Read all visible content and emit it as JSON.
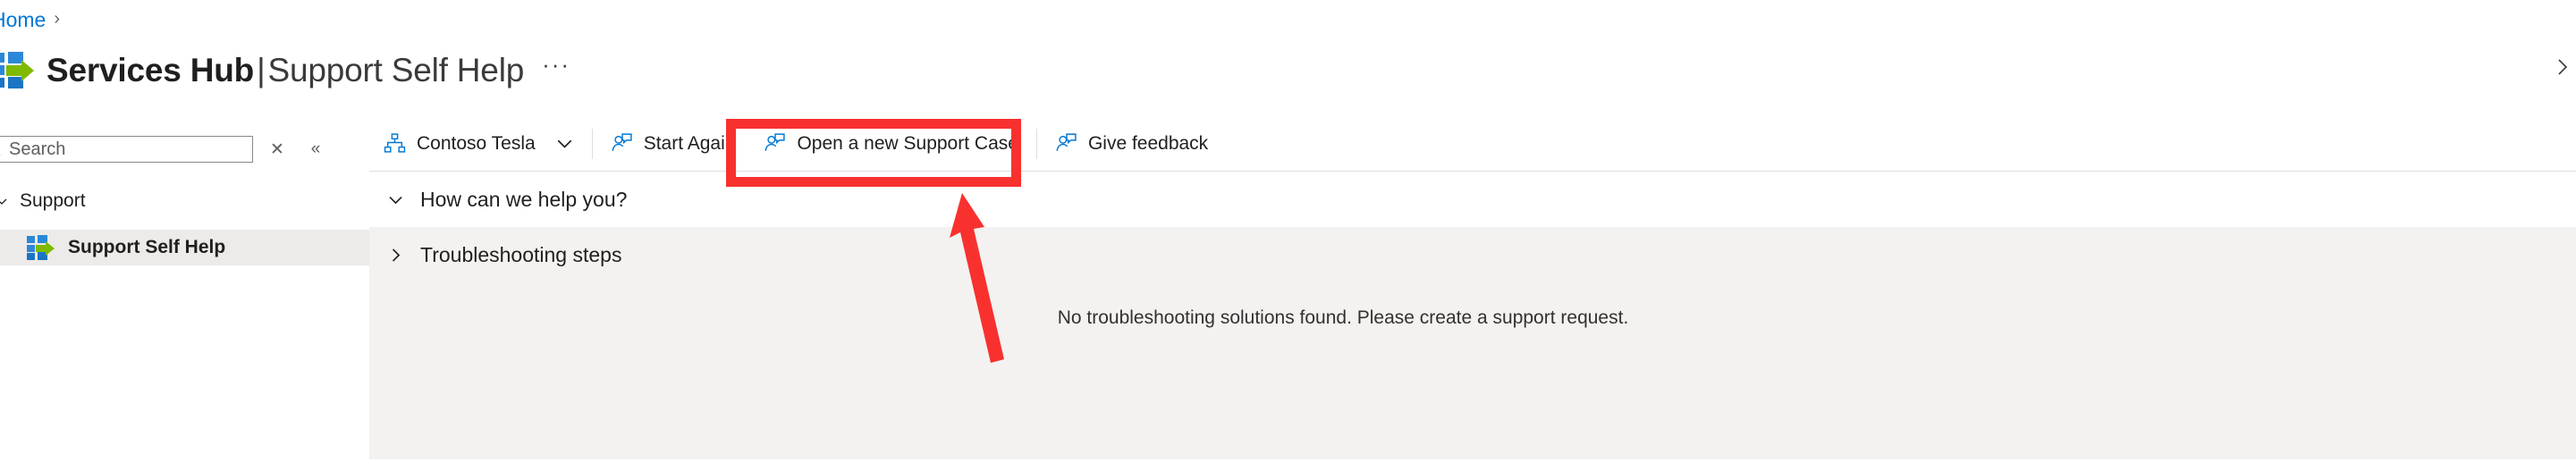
{
  "breadcrumb": {
    "items": [
      {
        "label": "Home",
        "separator": "›"
      }
    ]
  },
  "header": {
    "logo_icon": "services-hub-logo-icon",
    "title_bold": "Services Hub",
    "title_divider": "|",
    "title_light": "Support Self Help",
    "overflow_label": "···",
    "right_chevron_icon": "chevron-right-icon"
  },
  "sidebar": {
    "search": {
      "placeholder": "Search",
      "value": "",
      "search_icon": "search-icon",
      "clear_label": "✕",
      "clear_icon": "close-icon",
      "collapse_label": "«",
      "collapse_icon": "double-chevron-left-icon"
    },
    "group": {
      "label": "Support",
      "expanded": true,
      "chevron_icon": "chevron-down-icon"
    },
    "items": [
      {
        "label": "Support Self Help",
        "icon": "services-hub-logo-icon",
        "selected": true
      }
    ]
  },
  "command_bar": {
    "buttons": [
      {
        "label": "Contoso Tesla",
        "icon": "org-hierarchy-icon",
        "has_chevron": true,
        "chevron_icon": "chevron-down-icon",
        "highlighted": false
      },
      {
        "label": "Start Again",
        "icon": "user-feedback-icon",
        "has_chevron": false,
        "highlighted": false
      },
      {
        "label": "Open a new Support Case",
        "icon": "user-feedback-icon",
        "has_chevron": false,
        "highlighted": true
      },
      {
        "label": "Give feedback",
        "icon": "user-feedback-icon",
        "has_chevron": false,
        "highlighted": false
      }
    ]
  },
  "main": {
    "sections": [
      {
        "label": "How can we help you?",
        "expanded": true,
        "chevron_icon": "chevron-down-icon"
      },
      {
        "label": "Troubleshooting steps",
        "expanded": false,
        "chevron_icon": "chevron-right-icon"
      }
    ],
    "empty_message": "No troubleshooting solutions found. Please create a support request."
  },
  "annotations": {
    "highlight_color": "#F8312F",
    "highlight_target": "Open a new Support Case",
    "arrow_icon": "arrow-pointing-up-left-icon"
  },
  "colors": {
    "accent": "#0078d4",
    "link": "#0078d4",
    "panel_gray": "#F3F2F1",
    "selected_gray": "#EDEBE9",
    "logo_blue": "#2B88D8",
    "logo_green": "#7FBA00",
    "annotation_red": "#F8312F"
  }
}
